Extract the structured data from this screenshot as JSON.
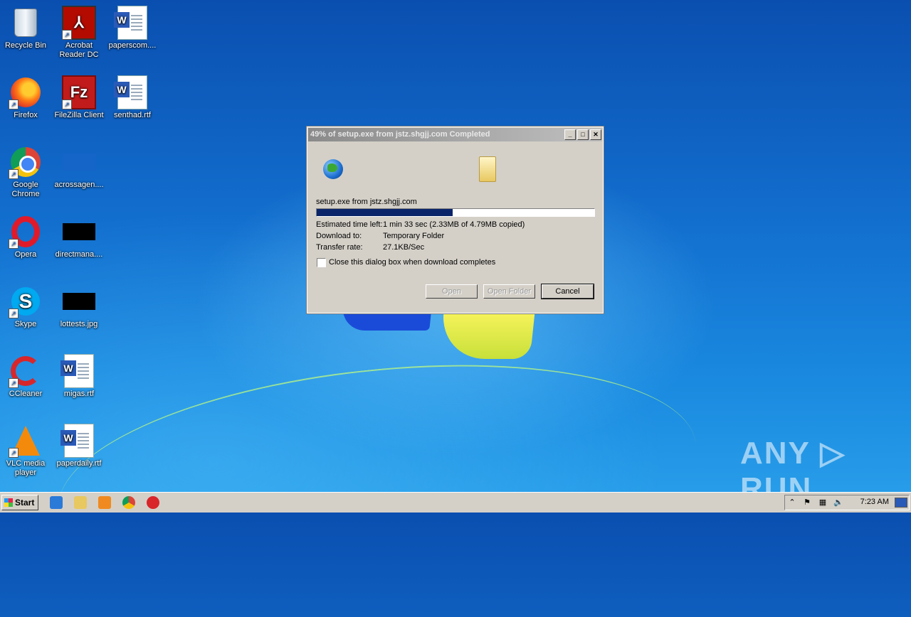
{
  "desktop_icons": [
    {
      "label": "Recycle Bin",
      "icon": "recycle-bin-icon"
    },
    {
      "label": "Acrobat Reader DC",
      "icon": "acrobat-icon"
    },
    {
      "label": "paperscom....",
      "icon": "word-doc-icon"
    },
    {
      "label": "Firefox",
      "icon": "firefox-icon"
    },
    {
      "label": "FileZilla Client",
      "icon": "filezilla-icon"
    },
    {
      "label": "senthad.rtf",
      "icon": "word-doc-icon"
    },
    {
      "label": "Google Chrome",
      "icon": "chrome-icon"
    },
    {
      "label": "acrossagen....",
      "icon": "image-thumb-icon"
    },
    {
      "label": "Opera",
      "icon": "opera-icon"
    },
    {
      "label": "directmana....",
      "icon": "image-thumb-icon"
    },
    {
      "label": "Skype",
      "icon": "skype-icon"
    },
    {
      "label": "lottests.jpg",
      "icon": "image-thumb-icon"
    },
    {
      "label": "CCleaner",
      "icon": "ccleaner-icon"
    },
    {
      "label": "migas.rtf",
      "icon": "word-doc-icon"
    },
    {
      "label": "VLC media player",
      "icon": "vlc-icon"
    },
    {
      "label": "paperdaily.rtf",
      "icon": "word-doc-icon"
    }
  ],
  "dialog": {
    "title": "49% of setup.exe from jstz.shgjj.com Completed",
    "title_buttons": {
      "minimize": "_",
      "maximize": "□",
      "close": "✕"
    },
    "file_text": "setup.exe from jstz.shgjj.com",
    "progress_fraction": 0.49,
    "rows": [
      {
        "label": "Estimated time left:",
        "value": "1 min 33 sec (2.33MB of 4.79MB copied)"
      },
      {
        "label": "Download to:",
        "value": "Temporary Folder"
      },
      {
        "label": "Transfer rate:",
        "value": "27.1KB/Sec"
      }
    ],
    "checkbox_label": "Close this dialog box when download completes",
    "buttons": {
      "open": "Open",
      "open_folder": "Open Folder",
      "cancel": "Cancel"
    }
  },
  "watermark": "ANY ▷ RUN",
  "taskbar": {
    "start_label": "Start",
    "clock": "7:23 AM",
    "tray_arrow": "⌃"
  }
}
